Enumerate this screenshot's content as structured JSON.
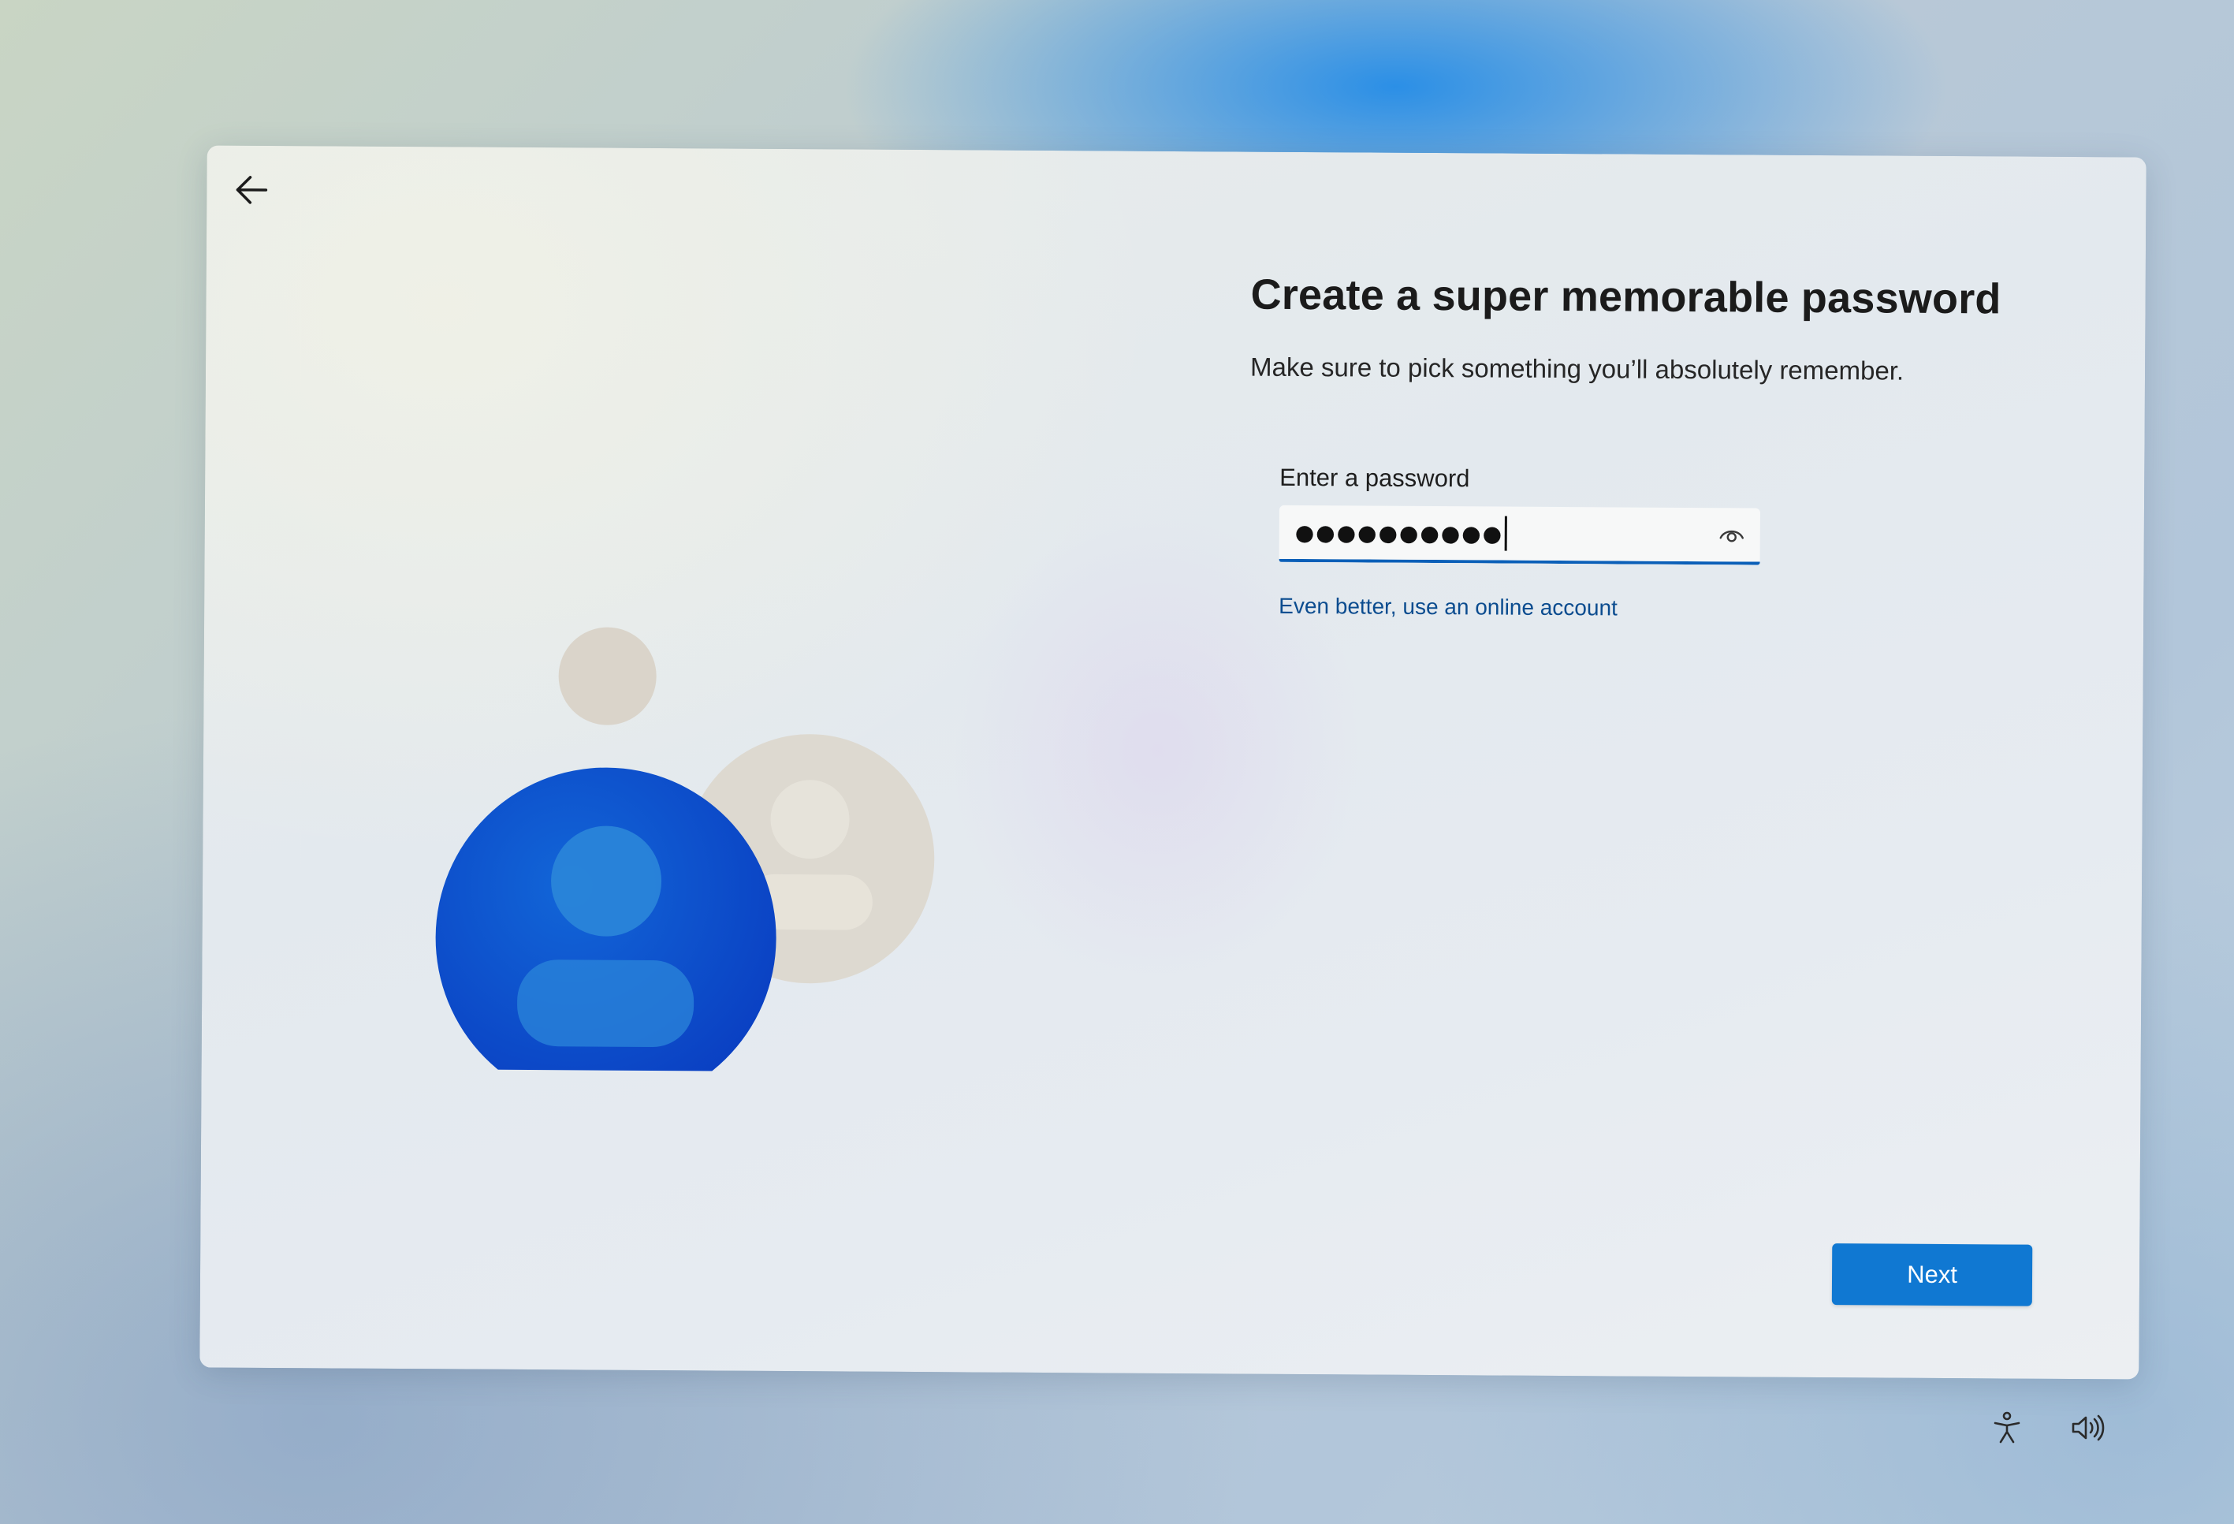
{
  "window": {
    "back_icon": "back-arrow-icon",
    "title": "Create a super memorable password",
    "subtitle": "Make sure to pick something you’ll absolutely remember.",
    "password_field": {
      "label": "Enter a password",
      "value": "●●●●●●●●●●",
      "reveal_icon": "eye-icon"
    },
    "online_account_link": "Even better, use an online account",
    "next_label": "Next",
    "illustration_icon": "user-account-icon"
  },
  "tray": {
    "accessibility_icon": "accessibility-icon",
    "volume_icon": "volume-icon"
  },
  "colors": {
    "accent": "#1078d2",
    "link": "#0b4c8f",
    "field_underline": "#0a5fb8",
    "avatar_blue": "#0c52c9",
    "avatar_beige": "#d8d2c6"
  }
}
